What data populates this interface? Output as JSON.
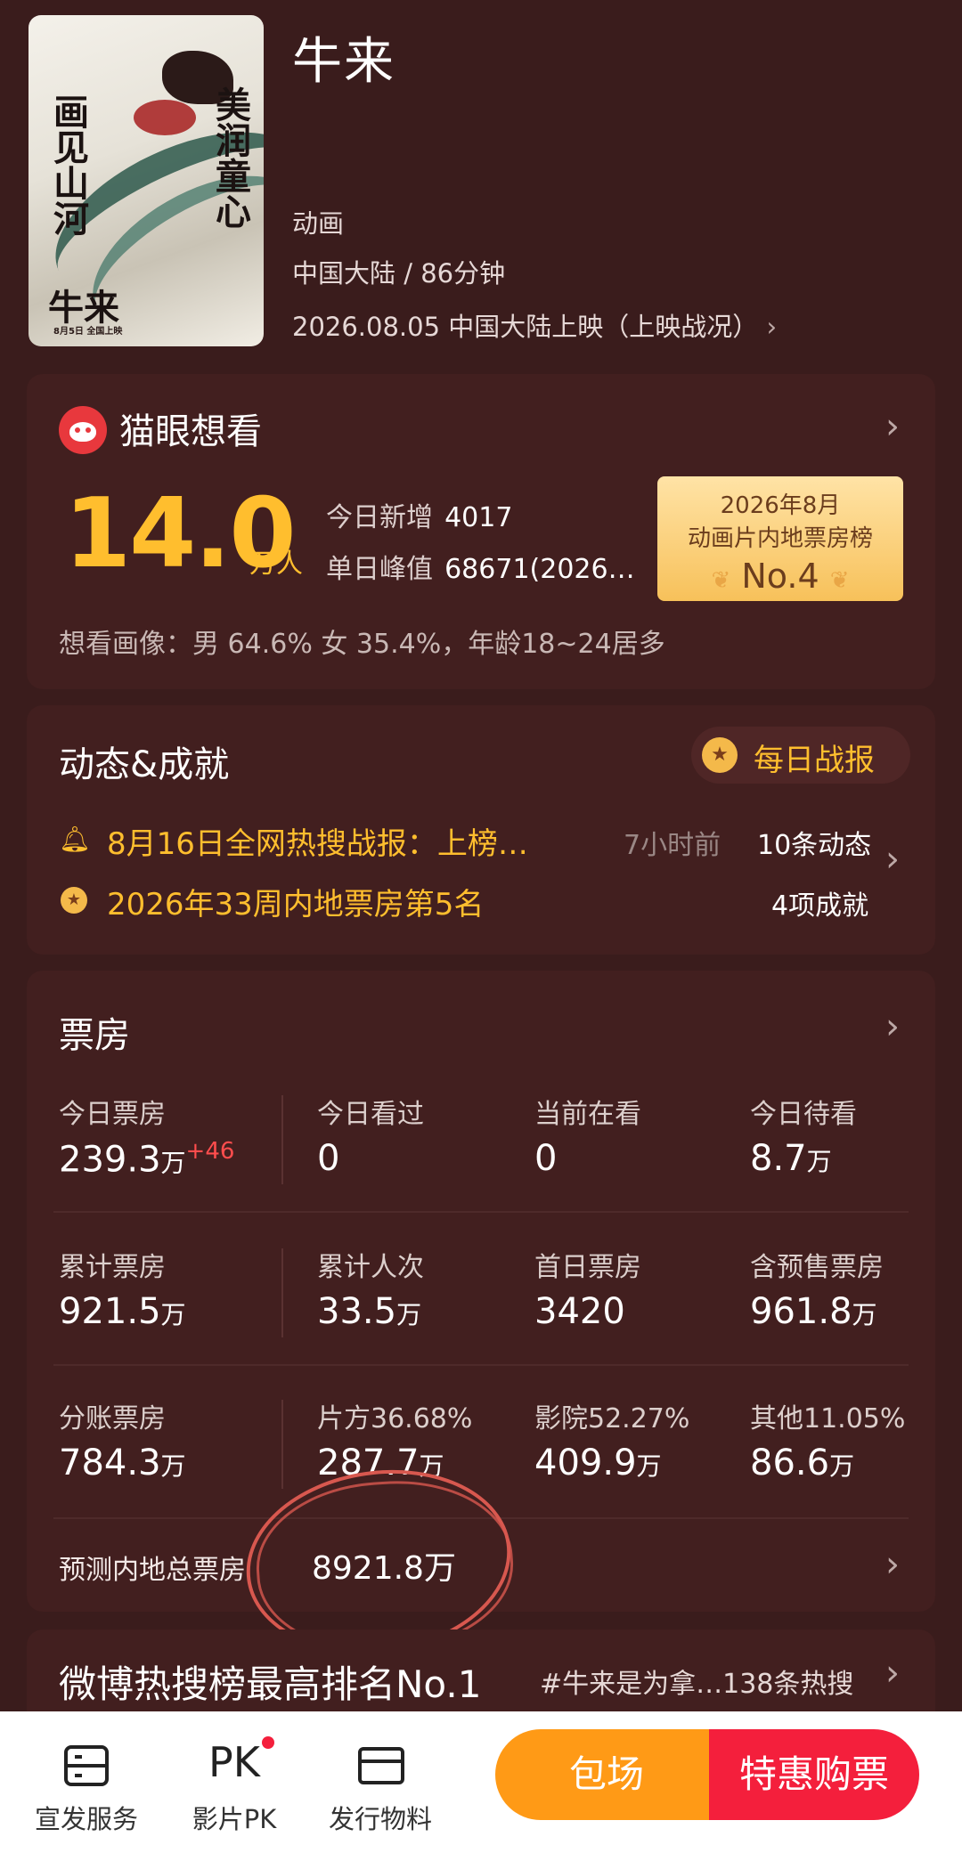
{
  "movie": {
    "poster_title": "牛来",
    "poster_vertical_left": "画见山河",
    "poster_vertical_right": "美润童心",
    "poster_date": "8月5日 全国上映",
    "title": "牛来",
    "genre": "动画",
    "region_duration": "中国大陆 / 86分钟",
    "release": "2026.08.05 中国大陆上映（上映战况）"
  },
  "want_to_see": {
    "title": "猫眼想看",
    "count": "14.0",
    "unit": "万人",
    "today_new_label": "今日新增",
    "today_new_value": "4017",
    "peak_label": "单日峰值",
    "peak_value": "68671(2026…",
    "portrait": "想看画像：男 64.6%  女 35.4%，年龄18~24居多",
    "rank_line1": "2026年8月",
    "rank_line2": "动画片内地票房榜",
    "rank_no": "No.4"
  },
  "news": {
    "title": "动态&成就",
    "daily_report": "每日战报",
    "item1_text": "8月16日全网热搜战报：上榜…",
    "item1_time": "7小时前",
    "item1_count": "10条动态",
    "item2_text": "2026年33周内地票房第5名",
    "item2_count": "4项成就"
  },
  "box_office": {
    "title": "票房",
    "row1": [
      {
        "label": "今日票房",
        "value": "239.3",
        "unit": "万",
        "delta": "+46"
      },
      {
        "label": "今日看过",
        "value": "0",
        "unit": ""
      },
      {
        "label": "当前在看",
        "value": "0",
        "unit": ""
      },
      {
        "label": "今日待看",
        "value": "8.7",
        "unit": "万"
      }
    ],
    "row2": [
      {
        "label": "累计票房",
        "value": "921.5",
        "unit": "万"
      },
      {
        "label": "累计人次",
        "value": "33.5",
        "unit": "万"
      },
      {
        "label": "首日票房",
        "value": "3420",
        "unit": ""
      },
      {
        "label": "含预售票房",
        "value": "961.8",
        "unit": "万"
      }
    ],
    "row3": [
      {
        "label": "分账票房",
        "value": "784.3",
        "unit": "万"
      },
      {
        "label": "片方36.68%",
        "value": "287.7",
        "unit": "万"
      },
      {
        "label": "影院52.27%",
        "value": "409.9",
        "unit": "万"
      },
      {
        "label": "其他11.05%",
        "value": "86.6",
        "unit": "万"
      }
    ],
    "forecast_label": "预测内地总票房",
    "forecast_value": "8921.8万"
  },
  "weibo": {
    "title": "微博热搜榜最高排名No.1",
    "tag": "#牛来是为拿…138条热搜"
  },
  "bottom_nav": [
    {
      "label": "宣发服务",
      "icon": "server-icon"
    },
    {
      "label": "影片PK",
      "icon": "pk-icon"
    },
    {
      "label": "发行物料",
      "icon": "folder-icon"
    }
  ],
  "buttons": {
    "private_screening": "包场",
    "discount_ticket": "特惠购票"
  },
  "colors": {
    "background": "#3a1c1c",
    "card": "#421f1f",
    "accent_gold": "#ffbe2e",
    "orange": "#ff9a16",
    "red": "#f41f3c"
  }
}
